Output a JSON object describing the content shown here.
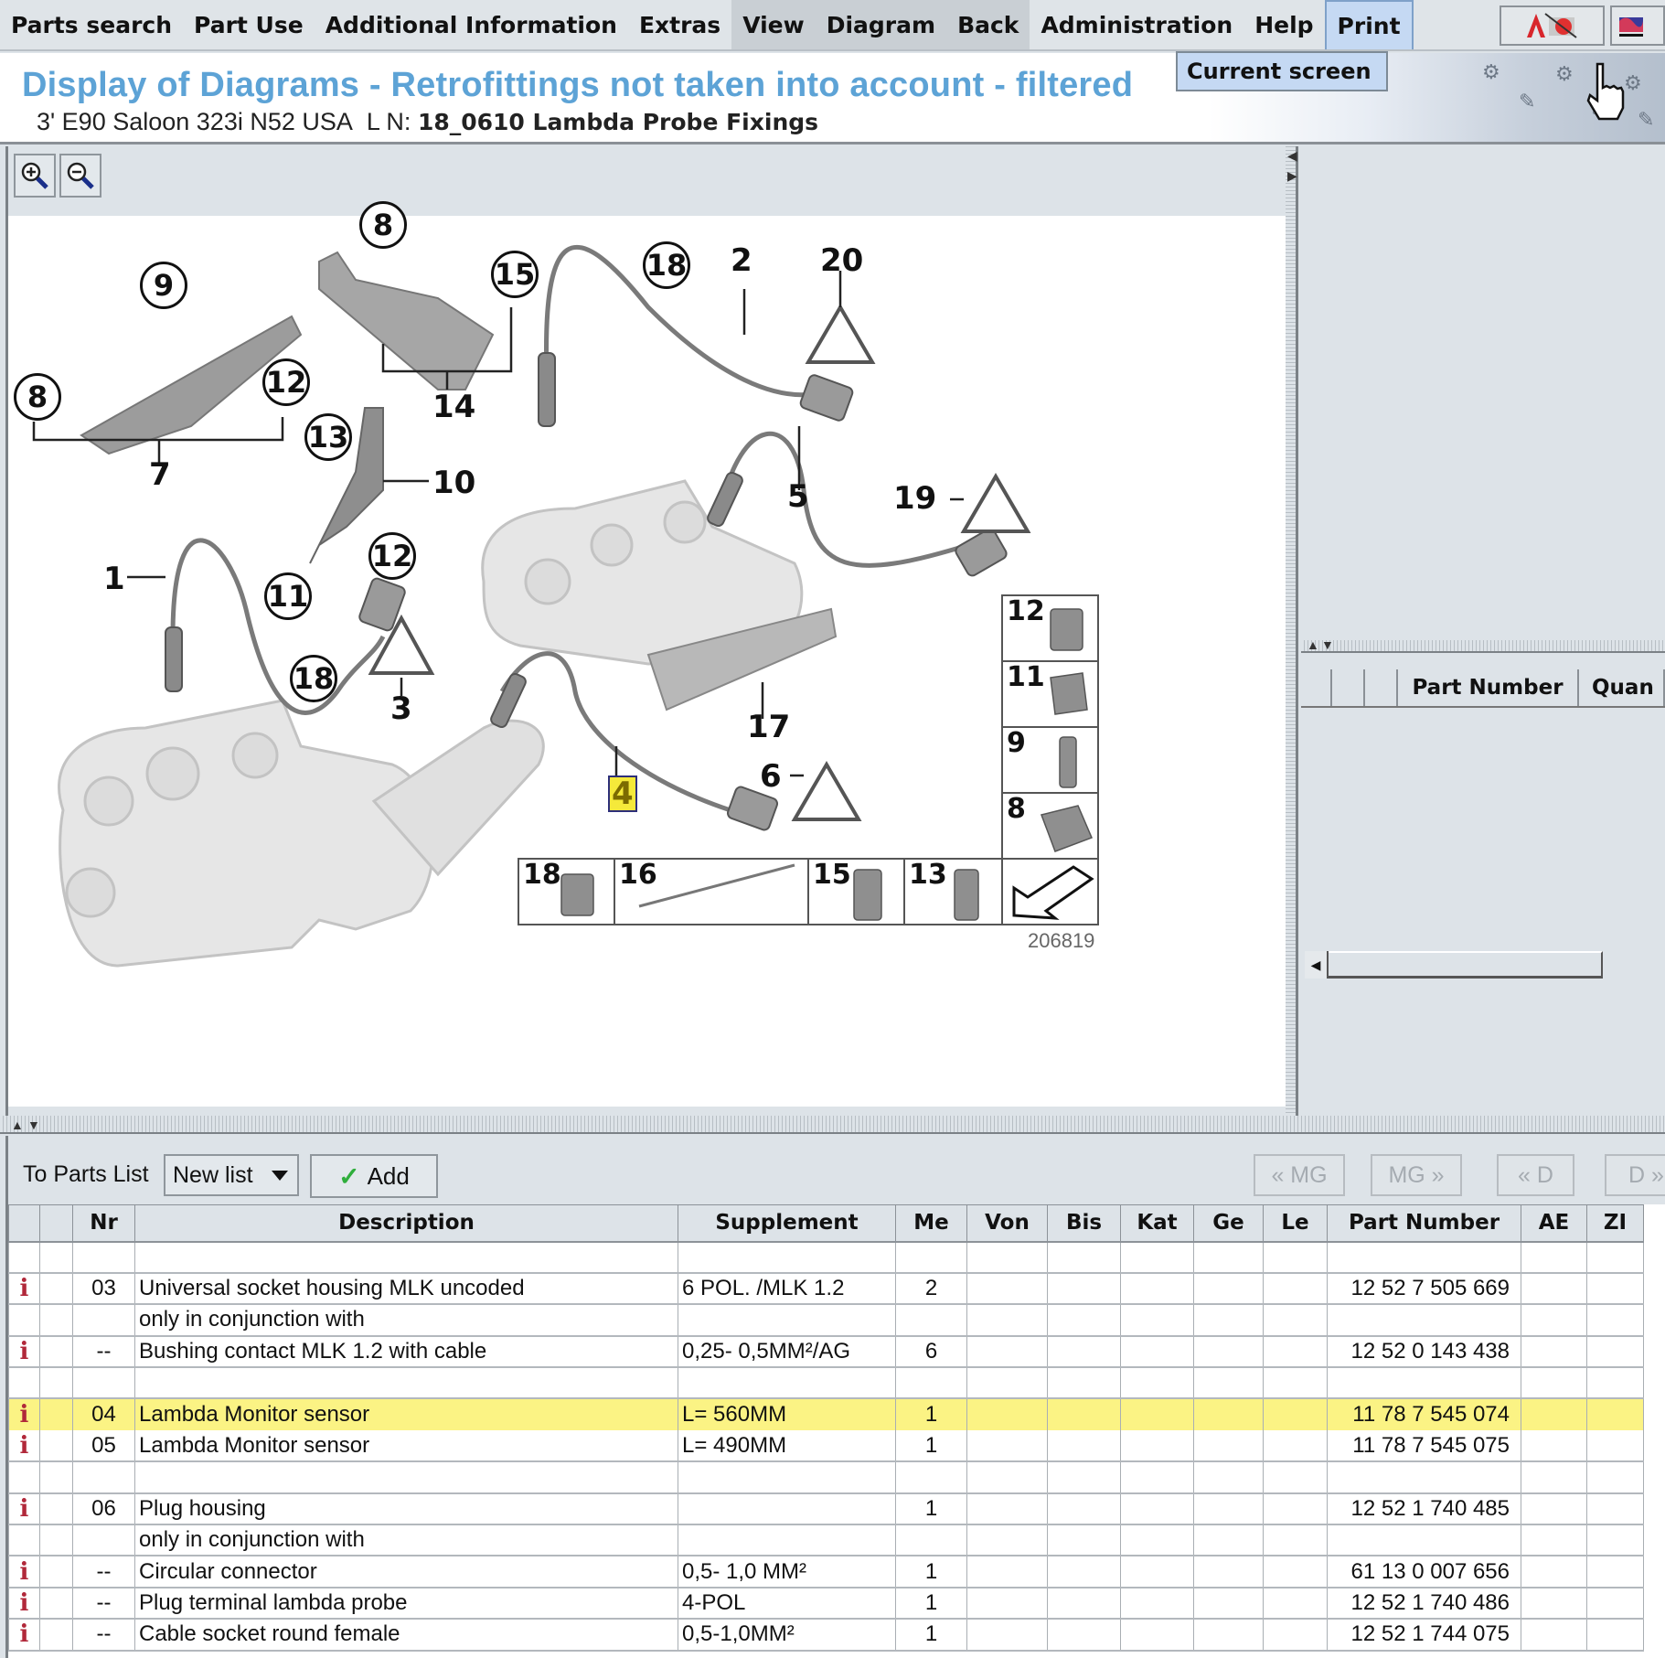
{
  "menubar": {
    "items": [
      {
        "label": "Parts search",
        "state": "normal"
      },
      {
        "label": "Part Use",
        "state": "normal"
      },
      {
        "label": "Additional Information",
        "state": "normal"
      },
      {
        "label": "Extras",
        "state": "normal"
      },
      {
        "label": "View",
        "state": "dim"
      },
      {
        "label": "Diagram",
        "state": "dim"
      },
      {
        "label": "Back",
        "state": "dim"
      },
      {
        "label": "Administration",
        "state": "normal"
      },
      {
        "label": "Help",
        "state": "normal"
      },
      {
        "label": "Print",
        "state": "active"
      }
    ],
    "print_dropdown": [
      "Current screen"
    ],
    "right_icons": [
      "autocad-a-icon",
      "flag-icon"
    ]
  },
  "header": {
    "title": "Display of Diagrams - Retrofittings not taken into account - filtered",
    "vehicle": "3' E90 Saloon 323i N52 USA",
    "ln_label": "L N:",
    "diagram_name": "18_0610 Lambda Probe Fixings"
  },
  "diagram": {
    "zoom_in_label": "zoom-in",
    "zoom_out_label": "zoom-out",
    "drawing_number": "206819",
    "highlighted_callout": "4",
    "callouts": [
      "1",
      "2",
      "3",
      "4",
      "5",
      "6",
      "7",
      "8",
      "9",
      "10",
      "11",
      "12",
      "13",
      "14",
      "15",
      "16",
      "17",
      "18",
      "19",
      "20"
    ],
    "inset_items": [
      "12",
      "11",
      "9",
      "8",
      "18",
      "16",
      "15",
      "13"
    ]
  },
  "right_pane": {
    "columns": [
      "",
      "",
      "",
      "Part Number",
      "Quan"
    ]
  },
  "parts_toolbar": {
    "to_parts_list_label": "To Parts List",
    "list_select_value": "New list",
    "add_label": "Add",
    "nav_buttons": [
      "« MG",
      "MG »",
      "« D",
      "D »"
    ]
  },
  "parts_table": {
    "columns": [
      "",
      "",
      "Nr",
      "Description",
      "Supplement",
      "Me",
      "Von",
      "Bis",
      "Kat",
      "Ge",
      "Le",
      "Part Number",
      "AE",
      "ZI"
    ],
    "rows": [
      {
        "info": false,
        "nr": "",
        "description": "",
        "supplement": "",
        "me": "",
        "part_number": "",
        "sep": true,
        "highlight": false
      },
      {
        "info": true,
        "nr": "03",
        "description": "Universal socket housing MLK uncoded",
        "supplement": "6 POL. /MLK 1.2",
        "me": "2",
        "part_number": "12 52 7 505 669",
        "sep": true,
        "highlight": false
      },
      {
        "info": false,
        "nr": "",
        "description": "only in conjunction with",
        "supplement": "",
        "me": "",
        "part_number": "",
        "sep": true,
        "highlight": false
      },
      {
        "info": true,
        "nr": "--",
        "description": "Bushing contact MLK 1.2 with cable",
        "supplement": "0,25- 0,5MM²/AG",
        "me": "6",
        "part_number": "12 52 0 143 438",
        "sep": true,
        "highlight": false
      },
      {
        "info": false,
        "nr": "",
        "description": "",
        "supplement": "",
        "me": "",
        "part_number": "",
        "sep": true,
        "highlight": false
      },
      {
        "info": true,
        "nr": "04",
        "description": "Lambda Monitor sensor",
        "supplement": "L= 560MM",
        "me": "1",
        "part_number": "11 78 7 545 074",
        "sep": false,
        "highlight": true
      },
      {
        "info": true,
        "nr": "05",
        "description": "Lambda Monitor sensor",
        "supplement": "L= 490MM",
        "me": "1",
        "part_number": "11 78 7 545 075",
        "sep": true,
        "highlight": false
      },
      {
        "info": false,
        "nr": "",
        "description": "",
        "supplement": "",
        "me": "",
        "part_number": "",
        "sep": true,
        "highlight": false
      },
      {
        "info": true,
        "nr": "06",
        "description": "Plug housing",
        "supplement": "",
        "me": "1",
        "part_number": "12 52 1 740 485",
        "sep": true,
        "highlight": false
      },
      {
        "info": false,
        "nr": "",
        "description": "only in conjunction with",
        "supplement": "",
        "me": "",
        "part_number": "",
        "sep": true,
        "highlight": false
      },
      {
        "info": true,
        "nr": "--",
        "description": "Circular connector",
        "supplement": "0,5- 1,0 MM²",
        "me": "1",
        "part_number": "61 13 0 007 656",
        "sep": true,
        "highlight": false
      },
      {
        "info": true,
        "nr": "--",
        "description": "Plug terminal lambda probe",
        "supplement": "4-POL",
        "me": "1",
        "part_number": "12 52 1 740 486",
        "sep": true,
        "highlight": false
      },
      {
        "info": true,
        "nr": "--",
        "description": "Cable socket round female",
        "supplement": "0,5-1,0MM²",
        "me": "1",
        "part_number": "12 52 1 744 075",
        "sep": true,
        "highlight": false
      }
    ]
  },
  "colors": {
    "title_blue": "#5da3d6",
    "highlight_yellow": "#fbf384",
    "info_red": "#b1283a",
    "panel_bg": "#dde3e8",
    "active_menu": "#c5d9f3"
  }
}
